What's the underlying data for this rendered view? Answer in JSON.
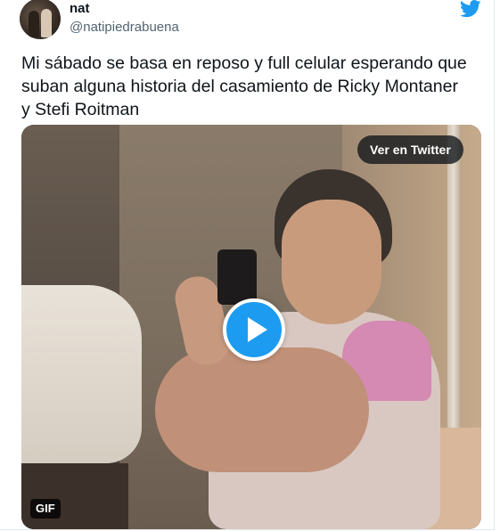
{
  "user": {
    "display_name": "nat",
    "handle": "@natipiedrabuena"
  },
  "tweet": {
    "text": "Mi sábado se basa en reposo y full celular esperando que\nsuban alguna historia del casamiento de Ricky Montaner\ny Stefi Roitman"
  },
  "media": {
    "view_on_twitter_label": "Ver en Twitter",
    "gif_badge": "GIF"
  },
  "icons": {
    "twitter": "twitter-bird-icon",
    "play": "play-icon"
  },
  "colors": {
    "twitter_blue": "#1d9bf0",
    "text_primary": "#0f1419",
    "text_secondary": "#536471"
  }
}
